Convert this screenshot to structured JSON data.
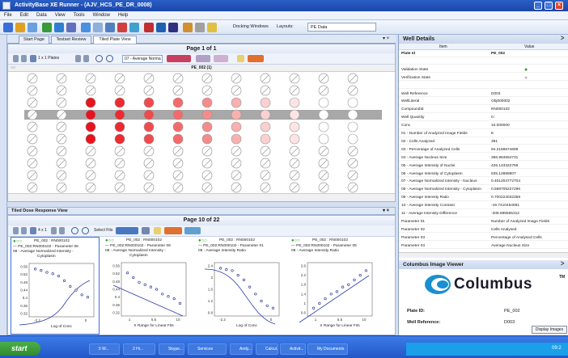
{
  "window": {
    "title": "ActivityBase XE Runner - (AJV_HCS_PE_DR_0008)"
  },
  "menu": [
    "File",
    "Edit",
    "Data",
    "View",
    "Tools",
    "Window",
    "Help"
  ],
  "toolbar": {
    "docking_label": "Docking Windows",
    "layouts_label": "Layouts:",
    "layout_value": "PE Data"
  },
  "doc_tabs": [
    "Start Page",
    "Testset Review",
    "Tiled Plate View"
  ],
  "plate_view": {
    "page_label": "Page 1 of 1",
    "plots_label": "1 x 1 Plates",
    "parameter_select": "07 - Average Norma",
    "plate_title": "PE_002 (1)",
    "well_rows": 10,
    "well_cols": 12,
    "colors": {
      "grey_band": "#a8a8a8",
      "red": "#e8141c",
      "empty_slash": "#999999"
    }
  },
  "dose_view": {
    "panel_title": "Tiled Dose Response View",
    "page_label": "Page 10 of 22",
    "plots_label": "4 x 1",
    "select_fits_label": "Select Fits",
    "charts": [
      {
        "title": "PE_002 : RN000102",
        "subtitle": "— PE_002:RN000102 - Parameter 08",
        "param": "08 - Average Normalized Intensity -",
        "param2": "Cytoplasm",
        "xlabel": "Log of Conc",
        "yticks": [
          "0.56",
          "0.52",
          "0.48",
          "0.44",
          "0.4",
          "0.36",
          "0.32"
        ],
        "xticks": [
          "-2.2",
          "0"
        ]
      },
      {
        "title": "PE_002 : RN000102",
        "subtitle": "— PE_002:RN000102 - Parameter 08",
        "param": "08 - Average Normalized Intensity -",
        "param2": "Cytoplasm",
        "xlabel": "X Range for Linear Fits",
        "yticks": [
          "0.56",
          "0.52",
          "0.48",
          "0.44",
          "0.4",
          "0.36",
          "0.32"
        ],
        "xticks": [
          "1",
          "5.5",
          "10"
        ]
      },
      {
        "title": "PE_002 : RN000102",
        "subtitle": "— PE_002:RN000102 - Parameter 01",
        "param": "09 - Average Intensity Ratio",
        "param2": "",
        "xlabel": "Log of Conc",
        "yticks": [
          "2.4",
          "2",
          "1.6",
          "1.2",
          "0.8"
        ],
        "xticks": [
          "-2.2",
          "0"
        ]
      },
      {
        "title": "PE_002 : RN000102",
        "subtitle": "— PE_002:RN000102 - Parameter 05",
        "param": "09 - Average Intensity Ratio",
        "param2": "",
        "xlabel": "X Range for Linear Fits",
        "yticks": [
          "2.6",
          "2.2",
          "1.8",
          "1.4",
          "1",
          "0.6"
        ],
        "xticks": [
          "1",
          "5.5",
          "10"
        ]
      }
    ]
  },
  "well_details": {
    "header": "Well Details",
    "col_item": "Item",
    "col_value": "Value",
    "rows": [
      [
        "Plate Id",
        "PE_002"
      ],
      [
        "",
        ""
      ],
      [
        "Validation State",
        ""
      ],
      [
        "Verification State",
        ""
      ],
      [
        "",
        ""
      ],
      [
        "Well Reference",
        "D003"
      ],
      [
        "WellLiteral",
        "Obj000002"
      ],
      [
        "CompoundId",
        "RN000102"
      ],
      [
        "Well Quantity",
        "0.:"
      ],
      [
        "Conc",
        "10.000000"
      ],
      [
        "01 - Number of Analyzed Image Fields",
        "8"
      ],
      [
        "02 - Cells Analyzed",
        "391"
      ],
      [
        "03 - Percentage of Analyzed Cells",
        "94.2168674699"
      ],
      [
        "04 - Average Nucleus Size",
        "366.984654731"
      ],
      [
        "05 - Average Intensity of Nuclei",
        "426.143322759"
      ],
      [
        "06 - Average Intensity of Cytoplasm",
        "635.12888807"
      ],
      [
        "07 - Average Normalized Intensity - Nucleus",
        "0.401204772704"
      ],
      [
        "08 - Average Normalized Intensity - Cytoplasm",
        "0.598705227296"
      ],
      [
        "09 - Average Intensity Ratio",
        "0.700224032359"
      ],
      [
        "10 - Average Intensity Contrast",
        "-19.7410454591"
      ],
      [
        "11 - Average Intensity Difference",
        "-208.985565312"
      ],
      [
        "Parameter 01",
        "Number of Analyzed Image Fields"
      ],
      [
        "Parameter 02",
        "Cells Analysed"
      ],
      [
        "Parameter 03",
        "Percentage of Analysed Cells"
      ],
      [
        "Parameter 04",
        "Average Nucleus Size"
      ]
    ]
  },
  "columbus": {
    "header": "Columbus Image Viewer",
    "logo_text": "Columbus",
    "tm": "TM",
    "plate_id_label": "Plate ID:",
    "plate_id_value": "PE_002",
    "well_ref_label": "Well Reference:",
    "well_ref_value": "D003",
    "display_button": "Display Images"
  },
  "taskbar": {
    "start_label": "start",
    "tasks": [
      "5 W...",
      "2 Hi...",
      "Skype...",
      "Services",
      "Andy...",
      "Calcul...",
      "Activit...",
      "My Documents"
    ],
    "clock": "09:2"
  }
}
